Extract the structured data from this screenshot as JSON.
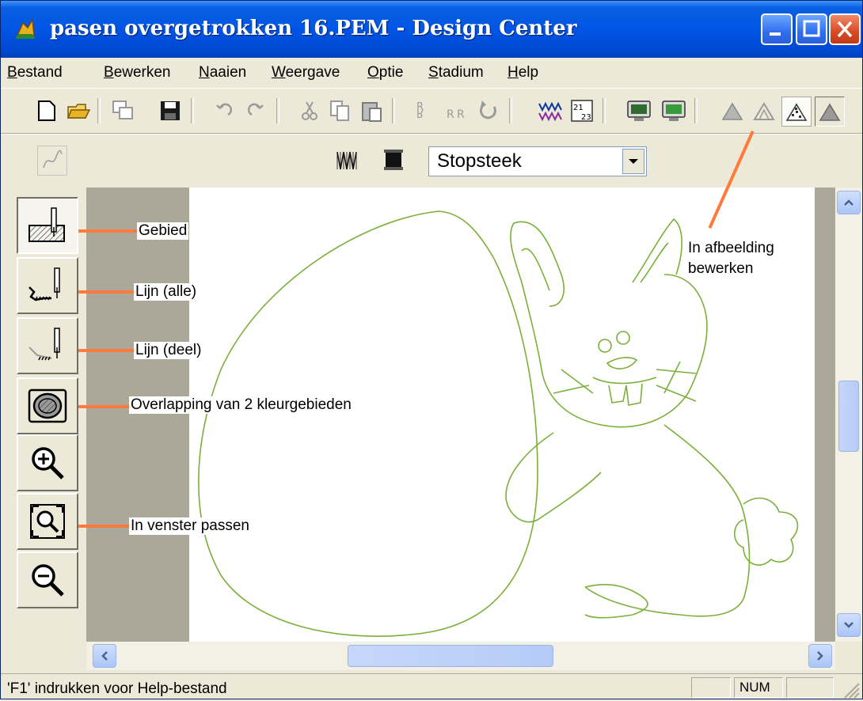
{
  "window": {
    "title": "pasen overgetrokken 16.PEM - Design Center",
    "icon": "bunny-app-icon"
  },
  "menu": [
    "Bestand",
    "Bewerken",
    "Naaien",
    "Weergave",
    "Optie",
    "Stadium",
    "Help"
  ],
  "stitch_combo": {
    "value": "Stopsteek"
  },
  "annotations": {
    "gebied": "Gebied",
    "lijn_alle": "Lijn (alle)",
    "lijn_deel": "Lijn (deel)",
    "overlapping": "Overlapping van 2 kleurgebieden",
    "venster": "In venster passen",
    "afbeelding_1": "In afbeelding",
    "afbeelding_2": "bewerken"
  },
  "status": {
    "help_text": "'F1' indrukken voor Help-bestand",
    "num": "NUM"
  },
  "colors": {
    "titlebar": "#0055e5",
    "annotation_line": "#ff7a3c",
    "outline": "#7ab03a"
  }
}
